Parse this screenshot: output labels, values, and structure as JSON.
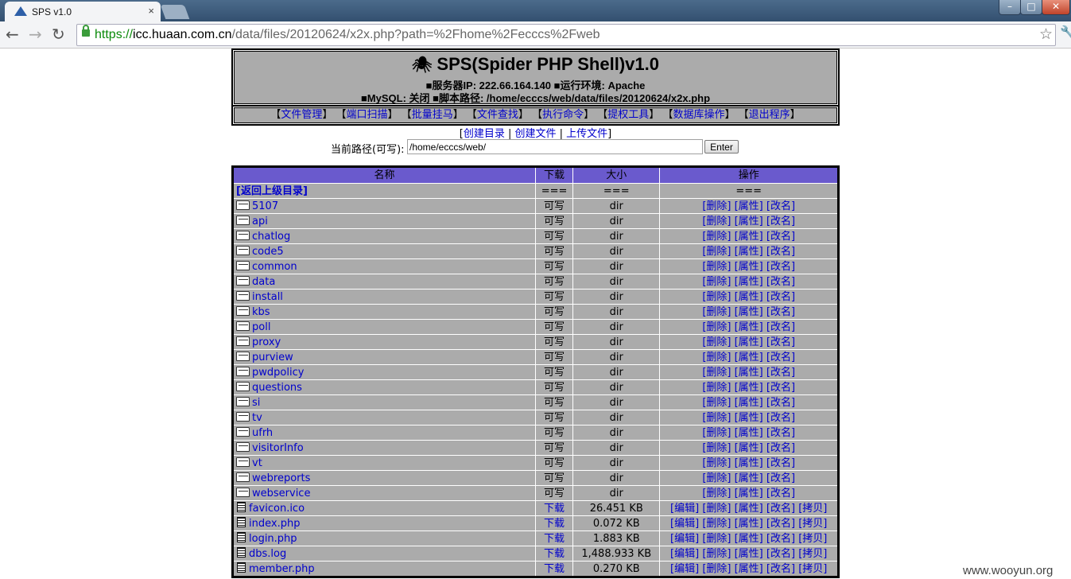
{
  "browser": {
    "tab_title": "SPS v1.0",
    "tab_close": "×",
    "url_scheme": "https://",
    "url_host": "icc.huaan.com.cn",
    "url_path": "/data/files/20120624/x2x.php?path=%2Fhome%2Fecccs%2Fweb",
    "win_min": "–",
    "win_max": "□",
    "win_close": "✕",
    "back_icon": "arrow-left-icon",
    "forward_icon": "arrow-right-icon",
    "reload_icon": "reload-icon"
  },
  "header": {
    "title": "SPS(Spider PHP Shell)v1.0",
    "info_line1": "■服务器IP: 222.66.164.140 ■运行环境: Apache",
    "info_line2": "■MySQL: 关闭 ■脚本路径: /home/ecccs/web/data/files/20120624/x2x.php"
  },
  "menu": [
    "文件管理",
    "端口扫描",
    "批量挂马",
    "文件查找",
    "执行命令",
    "提权工具",
    "数据库操作",
    "退出程序"
  ],
  "actions": {
    "create_dir": "创建目录",
    "create_file": "创建文件",
    "upload_file": "上传文件"
  },
  "path": {
    "label": "当前路径(可写):",
    "value": "/home/ecccs/web/",
    "enter": "Enter"
  },
  "table": {
    "headers": {
      "name": "名称",
      "download": "下载",
      "size": "大小",
      "ops": "操作"
    },
    "parent": {
      "name": "[返回上级目录]",
      "download": "===",
      "size": "===",
      "ops": "==="
    },
    "dir_ops": [
      "[删除]",
      "[属性]",
      "[改名]"
    ],
    "file_ops": [
      "[编辑]",
      "[删除]",
      "[属性]",
      "[改名]",
      "[拷贝]"
    ],
    "dirs": [
      {
        "name": "5107",
        "download": "可写",
        "size": "dir"
      },
      {
        "name": "api",
        "download": "可写",
        "size": "dir"
      },
      {
        "name": "chatlog",
        "download": "可写",
        "size": "dir"
      },
      {
        "name": "code5",
        "download": "可写",
        "size": "dir"
      },
      {
        "name": "common",
        "download": "可写",
        "size": "dir"
      },
      {
        "name": "data",
        "download": "可写",
        "size": "dir"
      },
      {
        "name": "install",
        "download": "可写",
        "size": "dir"
      },
      {
        "name": "kbs",
        "download": "可写",
        "size": "dir"
      },
      {
        "name": "poll",
        "download": "可写",
        "size": "dir"
      },
      {
        "name": "proxy",
        "download": "可写",
        "size": "dir"
      },
      {
        "name": "purview",
        "download": "可写",
        "size": "dir"
      },
      {
        "name": "pwdpolicy",
        "download": "可写",
        "size": "dir"
      },
      {
        "name": "questions",
        "download": "可写",
        "size": "dir"
      },
      {
        "name": "si",
        "download": "可写",
        "size": "dir"
      },
      {
        "name": "tv",
        "download": "可写",
        "size": "dir"
      },
      {
        "name": "ufrh",
        "download": "可写",
        "size": "dir"
      },
      {
        "name": "visitorInfo",
        "download": "可写",
        "size": "dir"
      },
      {
        "name": "vt",
        "download": "可写",
        "size": "dir"
      },
      {
        "name": "webreports",
        "download": "可写",
        "size": "dir"
      },
      {
        "name": "webservice",
        "download": "可写",
        "size": "dir"
      }
    ],
    "files": [
      {
        "name": "favicon.ico",
        "download": "下载",
        "size": "26.451 KB"
      },
      {
        "name": "index.php",
        "download": "下载",
        "size": "0.072 KB"
      },
      {
        "name": "login.php",
        "download": "下载",
        "size": "1.883 KB"
      },
      {
        "name": "dbs.log",
        "download": "下载",
        "size": "1,488.933 KB"
      },
      {
        "name": "member.php",
        "download": "下载",
        "size": "0.270 KB"
      }
    ]
  },
  "watermark": "www.wooyun.org",
  "colors": {
    "header_bg": "#ababab",
    "table_head": "#6a5acd",
    "link": "#0000cc"
  }
}
